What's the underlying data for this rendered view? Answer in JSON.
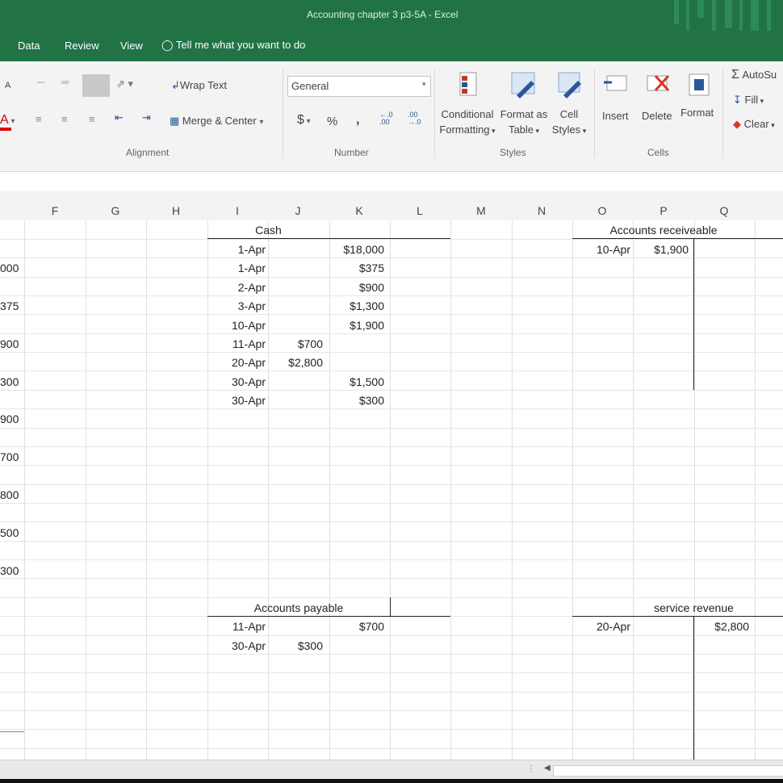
{
  "window": {
    "title": "Accounting chapter 3 p3-5A - Excel"
  },
  "tabs": [
    "Data",
    "Review",
    "View"
  ],
  "tell_me": "Tell me what you want to do",
  "ribbon": {
    "wrap_text": "Wrap Text",
    "merge_center": "Merge & Center",
    "number_format": "General",
    "currency": "$",
    "percent": "%",
    "comma": "Ɂ",
    "conditional_1": "Conditional",
    "conditional_2": "Formatting",
    "format_as_1": "Format as",
    "format_as_2": "Table",
    "cell_styles_1": "Cell",
    "cell_styles_2": "Styles",
    "insert": "Insert",
    "delete": "Delete",
    "format": "Format",
    "autosum": "AutoSu",
    "fill": "Fill",
    "clear": "Clear",
    "groups": {
      "alignment": "Alignment",
      "number": "Number",
      "styles": "Styles",
      "cells": "Cells"
    }
  },
  "columns": [
    "F",
    "G",
    "H",
    "I",
    "J",
    "K",
    "L",
    "M",
    "N",
    "O",
    "P",
    "Q"
  ],
  "col_e_fragments": [
    "000",
    "375",
    "900",
    "300",
    "900",
    "700",
    "800",
    "500",
    "300"
  ],
  "cash": {
    "title": "Cash",
    "rows": [
      {
        "date": "1-Apr",
        "debit": "",
        "credit": "$18,000"
      },
      {
        "date": "1-Apr",
        "debit": "",
        "credit": "$375"
      },
      {
        "date": "2-Apr",
        "debit": "",
        "credit": "$900"
      },
      {
        "date": "3-Apr",
        "debit": "",
        "credit": "$1,300"
      },
      {
        "date": "10-Apr",
        "debit": "",
        "credit": "$1,900"
      },
      {
        "date": "11-Apr",
        "debit": "$700",
        "credit": ""
      },
      {
        "date": "20-Apr",
        "debit": "$2,800",
        "credit": ""
      },
      {
        "date": "30-Apr",
        "debit": "",
        "credit": "$1,500"
      },
      {
        "date": "30-Apr",
        "debit": "",
        "credit": "$300"
      }
    ]
  },
  "accounts_receivable": {
    "title": "Accounts receiveable",
    "rows": [
      {
        "date": "10-Apr",
        "amount": "$1,900"
      }
    ]
  },
  "accounts_payable": {
    "title": "Accounts payable",
    "rows": [
      {
        "date": "11-Apr",
        "debit": "",
        "credit": "$700"
      },
      {
        "date": "30-Apr",
        "debit": "$300",
        "credit": ""
      }
    ]
  },
  "service_revenue": {
    "title": "service revenue",
    "rows": [
      {
        "date": "20-Apr",
        "amount": "$2,800"
      }
    ]
  }
}
